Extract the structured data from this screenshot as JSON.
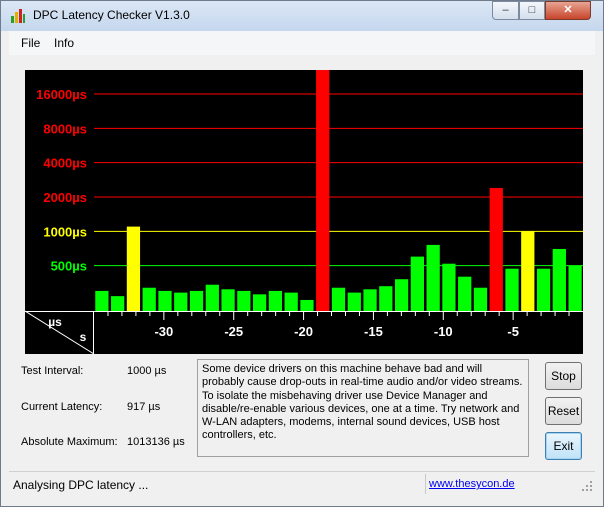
{
  "window": {
    "title": "DPC Latency Checker V1.3.0"
  },
  "caption_buttons": {
    "minimize": "–",
    "maximize": "□",
    "close": "✕"
  },
  "menu": {
    "items": [
      "File",
      "Info"
    ]
  },
  "icons": {
    "app": "latency-meter-icon",
    "minimize": "minimize-icon",
    "maximize": "maximize-icon",
    "close": "close-icon",
    "grip": "resize-grip-icon"
  },
  "colors": {
    "chart_bg": "#000000",
    "red": "#ff0000",
    "yellow": "#ffff00",
    "green": "#00ff00",
    "white": "#ffffff"
  },
  "chart_data": {
    "type": "bar",
    "y_unit_label": "µs",
    "x_unit_label": "s",
    "y_ticks": [
      {
        "label": "16000µs",
        "value": 16000,
        "color": "red"
      },
      {
        "label": "8000µs",
        "value": 8000,
        "color": "red"
      },
      {
        "label": "4000µs",
        "value": 4000,
        "color": "red"
      },
      {
        "label": "2000µs",
        "value": 2000,
        "color": "red"
      },
      {
        "label": "1000µs",
        "value": 1000,
        "color": "yellow"
      },
      {
        "label": "500µs",
        "value": 500,
        "color": "green"
      }
    ],
    "x_ticks": [
      -30,
      -25,
      -20,
      -15,
      -10,
      -5
    ],
    "x_tick_labels": [
      "-30",
      "-25",
      "-20",
      "-15",
      "-10",
      "-5"
    ],
    "x_range": [
      -35,
      0
    ],
    "y_scale": "log",
    "y_range": [
      200,
      26000
    ],
    "bar_values": [
      300,
      270,
      1100,
      320,
      300,
      290,
      300,
      340,
      310,
      300,
      280,
      300,
      290,
      250,
      1013136,
      320,
      290,
      310,
      330,
      380,
      600,
      760,
      520,
      400,
      320,
      2400,
      470,
      1000,
      470,
      700,
      500
    ]
  },
  "info": {
    "interval_label": "Test Interval:",
    "interval_value": "1000 µs",
    "current_label": "Current Latency:",
    "current_value": "917 µs",
    "max_label": "Absolute Maximum:",
    "max_value": "1013136 µs"
  },
  "message": "Some device drivers on this machine behave bad and will probably cause drop-outs in real-time audio and/or video streams. To isolate the misbehaving driver use Device Manager and disable/re-enable various devices, one at a time. Try network and W-LAN adapters, modems, internal sound devices, USB host controllers, etc.",
  "buttons": {
    "stop": "Stop",
    "reset": "Reset",
    "exit": "Exit"
  },
  "status": {
    "text": "Analysing DPC latency ...",
    "link": "www.thesycon.de"
  }
}
